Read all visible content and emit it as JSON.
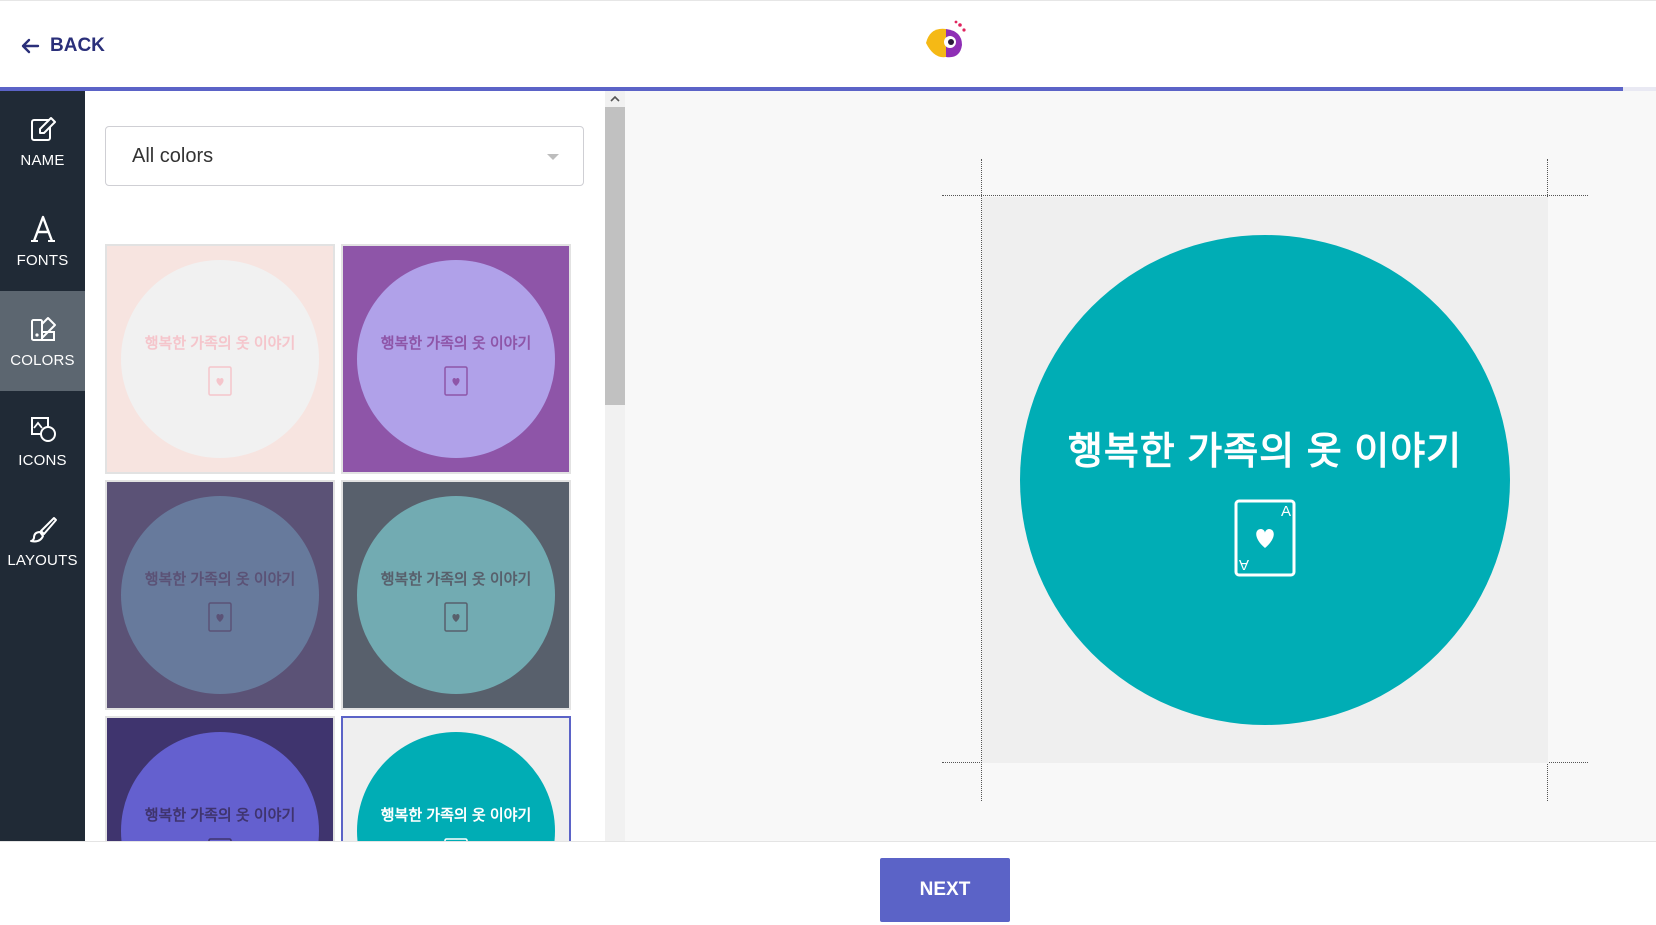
{
  "header": {
    "back_label": "BACK",
    "progress_percent": 98
  },
  "sidebar": {
    "items": [
      {
        "label": "NAME",
        "icon": "pencil-edit-icon"
      },
      {
        "label": "FONTS",
        "icon": "font-letter-icon"
      },
      {
        "label": "COLORS",
        "icon": "color-palette-icon",
        "active": true
      },
      {
        "label": "ICONS",
        "icon": "shapes-icon"
      },
      {
        "label": "LAYOUTS",
        "icon": "brush-icon"
      }
    ]
  },
  "panel": {
    "color_filter_value": "All colors",
    "tile_text": "행복한 가족의 옷 이야기",
    "tiles": [
      {
        "bg": "#f7e4e0",
        "circle": "#f1f1f1",
        "text": "#f5c5cb"
      },
      {
        "bg": "#8e55a8",
        "circle": "#b0a1e9",
        "text": "#8e55a8"
      },
      {
        "bg": "#5b5276",
        "circle": "#677a9c",
        "text": "#5b5276"
      },
      {
        "bg": "#58606c",
        "circle": "#72abb2",
        "text": "#58606c"
      },
      {
        "bg": "#3f346e",
        "circle": "#6460cf",
        "text": "#3f346e"
      },
      {
        "bg": "#efefef",
        "circle": "#00adb5",
        "text": "#ffffff",
        "selected": true
      }
    ]
  },
  "preview": {
    "text": "행복한 가족의 옷 이야기",
    "circle_color": "#00adb5",
    "background_color": "#efefef",
    "icon": "ace-of-hearts-card-icon"
  },
  "footer": {
    "next_label": "NEXT"
  }
}
